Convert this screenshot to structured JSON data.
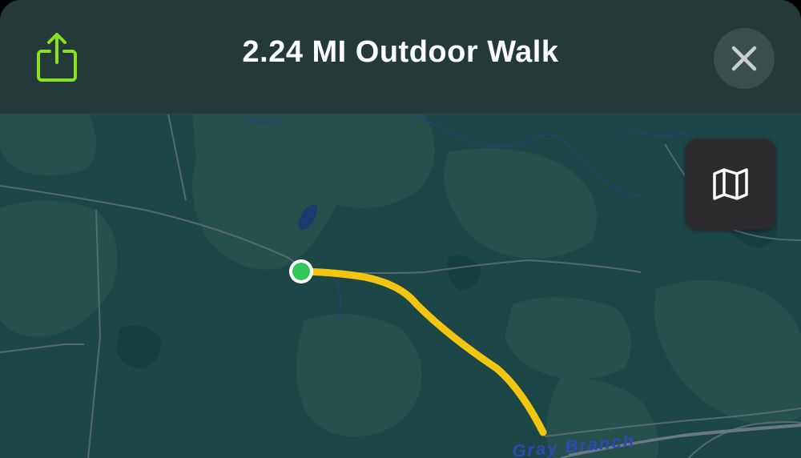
{
  "header": {
    "title": "2.24 MI Outdoor Walk",
    "share_icon": "share-icon",
    "close_icon": "close-icon"
  },
  "map": {
    "road_label": "Gray Branch",
    "map_mode_icon": "map-icon",
    "start_marker_color": "#34c759",
    "route_color": "#f2c511"
  },
  "colors": {
    "accent_green": "#8be020",
    "header_bg": "#243a38",
    "map_forest": "#1d4746",
    "map_clearing": "#25504c"
  }
}
